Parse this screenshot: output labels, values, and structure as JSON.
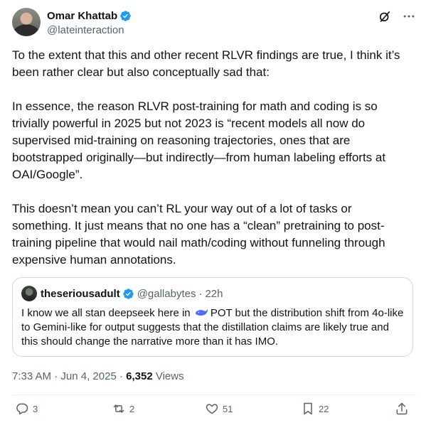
{
  "author": {
    "display_name": "Omar Khattab",
    "handle": "@lateinteraction"
  },
  "icons": {
    "verified": "verified-badge-icon",
    "grok": "grok-icon",
    "more": "more-icon",
    "whale": "deepseek-whale-icon",
    "reply": "reply-icon",
    "retweet": "retweet-icon",
    "like": "like-icon",
    "bookmark": "bookmark-icon",
    "share": "share-icon"
  },
  "colors": {
    "text": "#0f1419",
    "muted": "#536471",
    "verified": "#1d9bf0",
    "border": "#cfd9de"
  },
  "tweet": {
    "text": "To the extent that this and other recent RLVR findings are true, I think it’s been rather clear but also conceptually sad that:\n\nIn essence, the reason RLVR post-training for math and coding is so trivially powerful in 2025 but not 2023 is “recent models all now do supervised mid-training on reasoning trajectories, ones that are bootstrapped originally—but indirectly—from human labeling efforts at OAI/Google”.\n\nThis doesn’t mean you can’t RL your way out of a lot of tasks or something. It just means that no one has a “clean” pretraining to post-training pipeline that would nail math/coding without funneling through expensive human annotations."
  },
  "quote": {
    "display_name": "theseriousadult",
    "handle": "@gallabytes",
    "separator": "·",
    "time": "22h",
    "text_before": "I know we all stan deepseek here in ",
    "text_after": "POT but the distribution shift from 4o-like to Gemini-like for output suggests that the distillation claims are likely true and this should change the narrative more than it has IMO."
  },
  "meta": {
    "time": "7:33 AM",
    "sep1": " · ",
    "date": "Jun 4, 2025",
    "sep2": " · ",
    "views_count": "6,352",
    "views_label": " Views"
  },
  "actions": {
    "replies": "3",
    "reposts": "2",
    "likes": "51",
    "bookmarks": "22"
  }
}
